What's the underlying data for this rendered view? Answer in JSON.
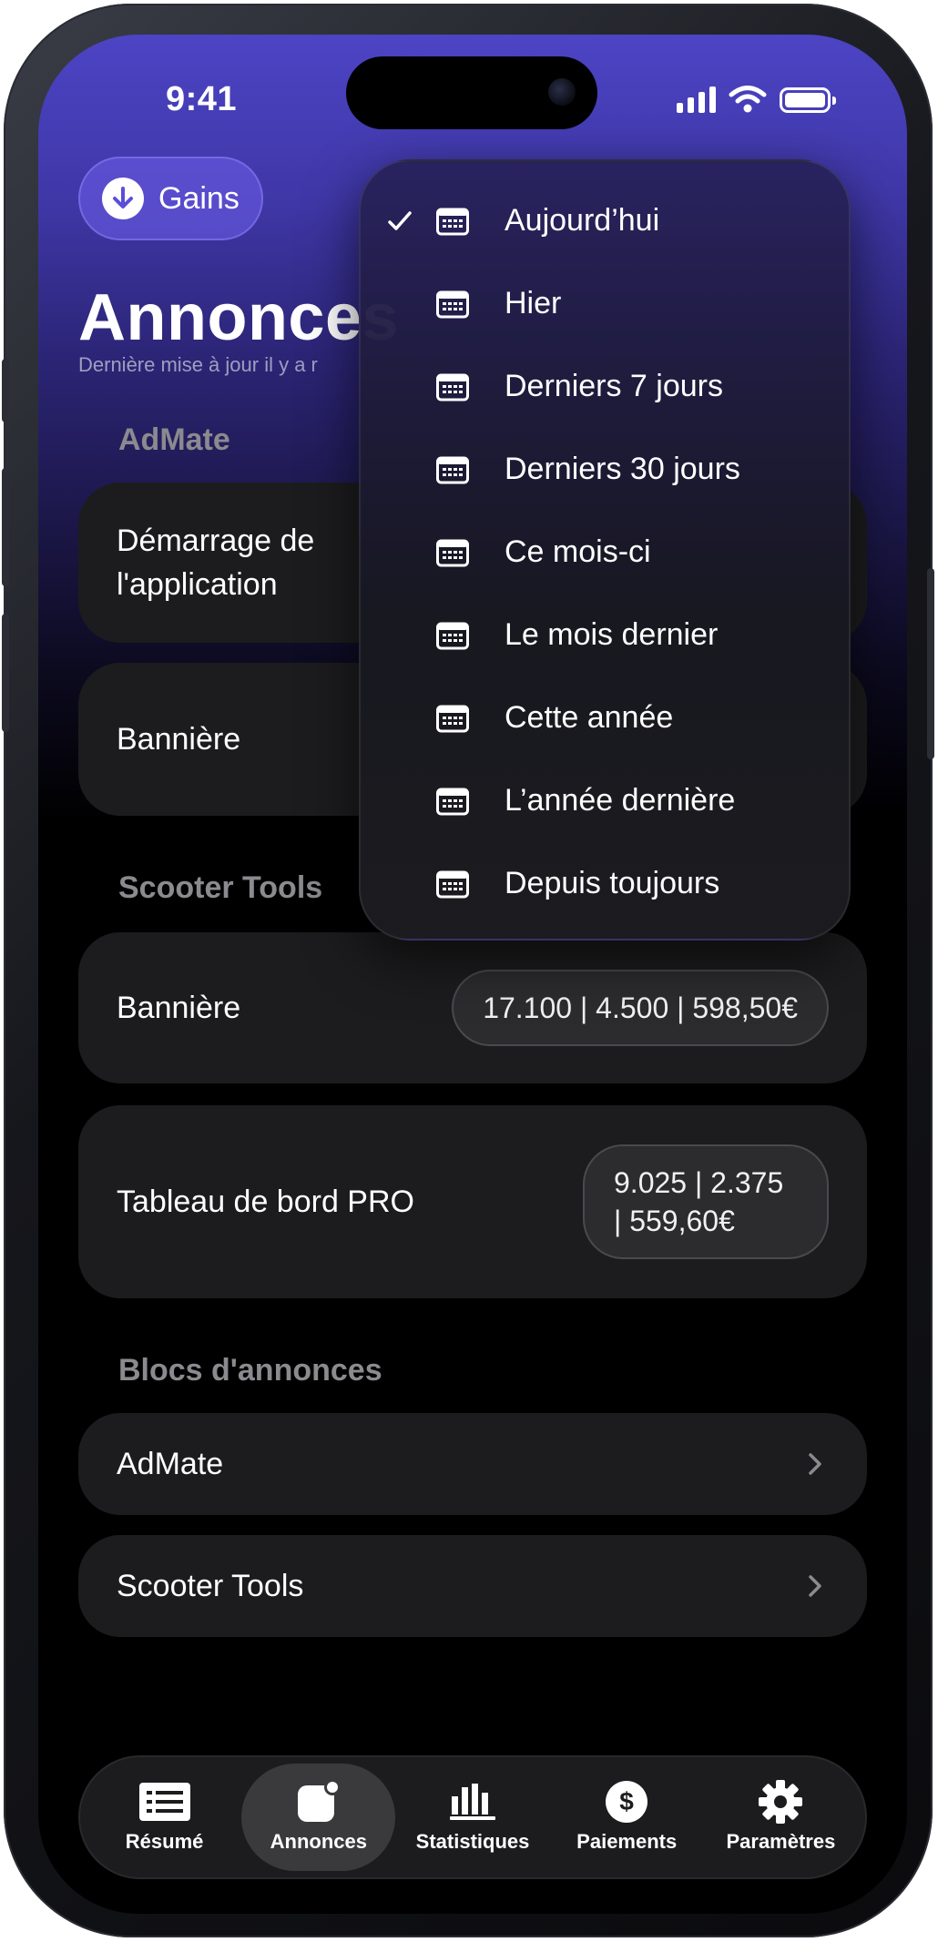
{
  "status_bar": {
    "time": "9:41"
  },
  "header": {
    "gains_button": "Gains",
    "title": "Annonces",
    "subtitle": "Dernière mise à jour il y a r"
  },
  "dropdown": {
    "items": [
      {
        "label": "Aujourd’hui",
        "selected": true
      },
      {
        "label": "Hier",
        "selected": false
      },
      {
        "label": "Derniers 7 jours",
        "selected": false
      },
      {
        "label": "Derniers 30 jours",
        "selected": false
      },
      {
        "label": "Ce mois-ci",
        "selected": false
      },
      {
        "label": "Le mois dernier",
        "selected": false
      },
      {
        "label": "Cette année",
        "selected": false
      },
      {
        "label": "L’année dernière",
        "selected": false
      },
      {
        "label": "Depuis toujours",
        "selected": false
      }
    ]
  },
  "sections": {
    "admate": {
      "title": "AdMate",
      "rows": [
        {
          "label_line1": "Démarrage de",
          "label_line2": "l'application"
        },
        {
          "label": "Bannière"
        }
      ]
    },
    "scooter": {
      "title": "Scooter Tools",
      "rows": [
        {
          "label": "Bannière",
          "value": "17.100 | 4.500 | 598,50€"
        },
        {
          "label": "Tableau de bord PRO",
          "value_line1": "9.025 | 2.375",
          "value_line2": "| 559,60€"
        }
      ]
    },
    "blocks": {
      "title": "Blocs d'annonces",
      "items": [
        {
          "label": "AdMate"
        },
        {
          "label": "Scooter Tools"
        }
      ]
    }
  },
  "tabbar": {
    "active": "Annonces",
    "tabs": [
      {
        "label": "Résumé",
        "icon": "list-icon"
      },
      {
        "label": "Annonces",
        "icon": "ad-badge-icon"
      },
      {
        "label": "Statistiques",
        "icon": "bar-chart-icon"
      },
      {
        "label": "Paiements",
        "icon": "dollar-icon"
      },
      {
        "label": "Paramètres",
        "icon": "gear-icon"
      }
    ]
  },
  "colors": {
    "accent": "#5b4fd8",
    "card": "#1c1c1e",
    "section_header": "#8a8a8f"
  }
}
